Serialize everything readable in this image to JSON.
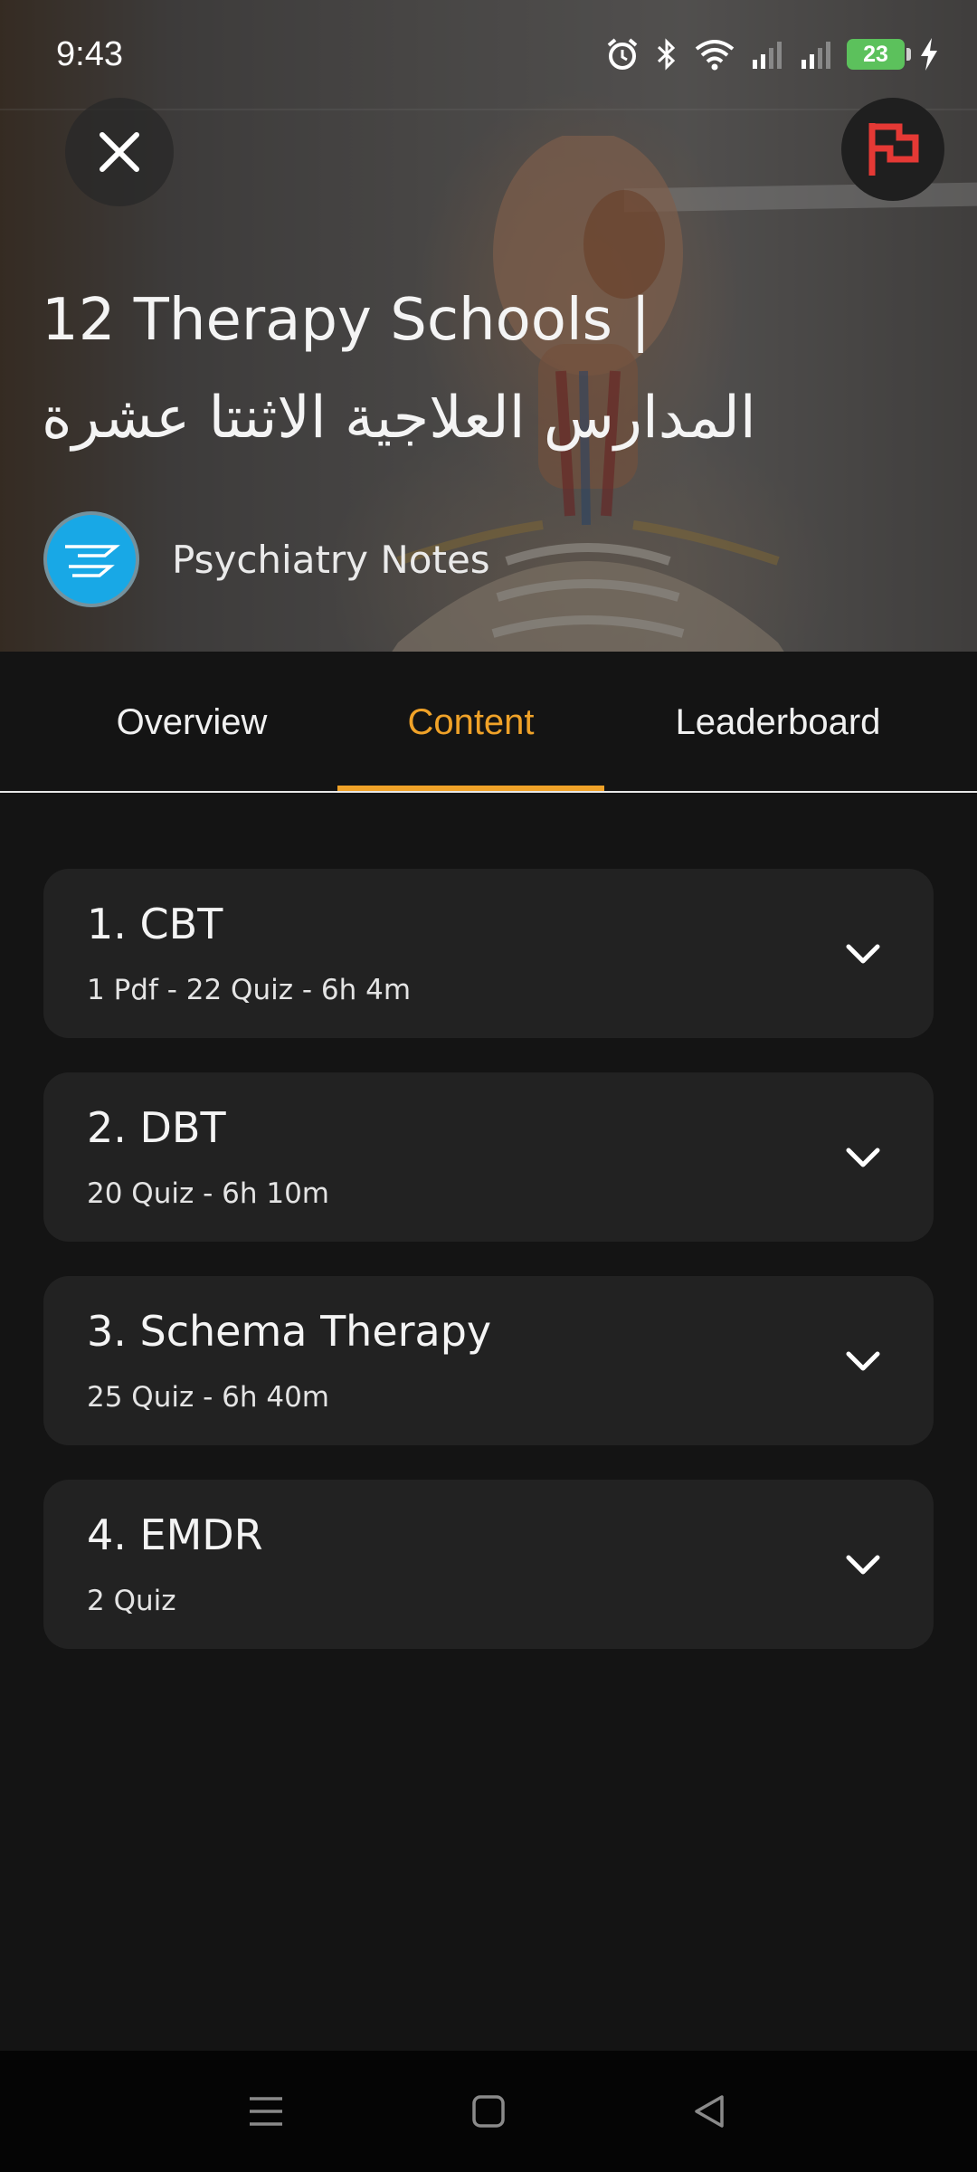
{
  "status_bar": {
    "time": "9:43",
    "battery_level": "23",
    "icons": [
      "alarm-icon",
      "bluetooth-icon",
      "wifi-icon",
      "signal-icon",
      "signal-icon",
      "battery-icon",
      "charging-icon"
    ]
  },
  "header": {
    "title": "12 Therapy Schools | المدارس العلاجية الاثنتا عشرة",
    "author": "Psychiatry Notes",
    "flag_color": "#e53935"
  },
  "tabs": [
    {
      "label": "Overview",
      "active": false
    },
    {
      "label": "Content",
      "active": true
    },
    {
      "label": "Leaderboard",
      "active": false
    }
  ],
  "accent_color": "#f0a228",
  "sections": [
    {
      "title": "1. CBT",
      "meta": "1 Pdf - 22 Quiz - 6h 4m"
    },
    {
      "title": "2. DBT",
      "meta": "20 Quiz - 6h 10m"
    },
    {
      "title": "3. Schema Therapy",
      "meta": "25 Quiz - 6h 40m"
    },
    {
      "title": "4. EMDR",
      "meta": "2 Quiz"
    }
  ],
  "nav": {
    "icons": [
      "menu-icon",
      "home-icon",
      "back-icon"
    ]
  }
}
